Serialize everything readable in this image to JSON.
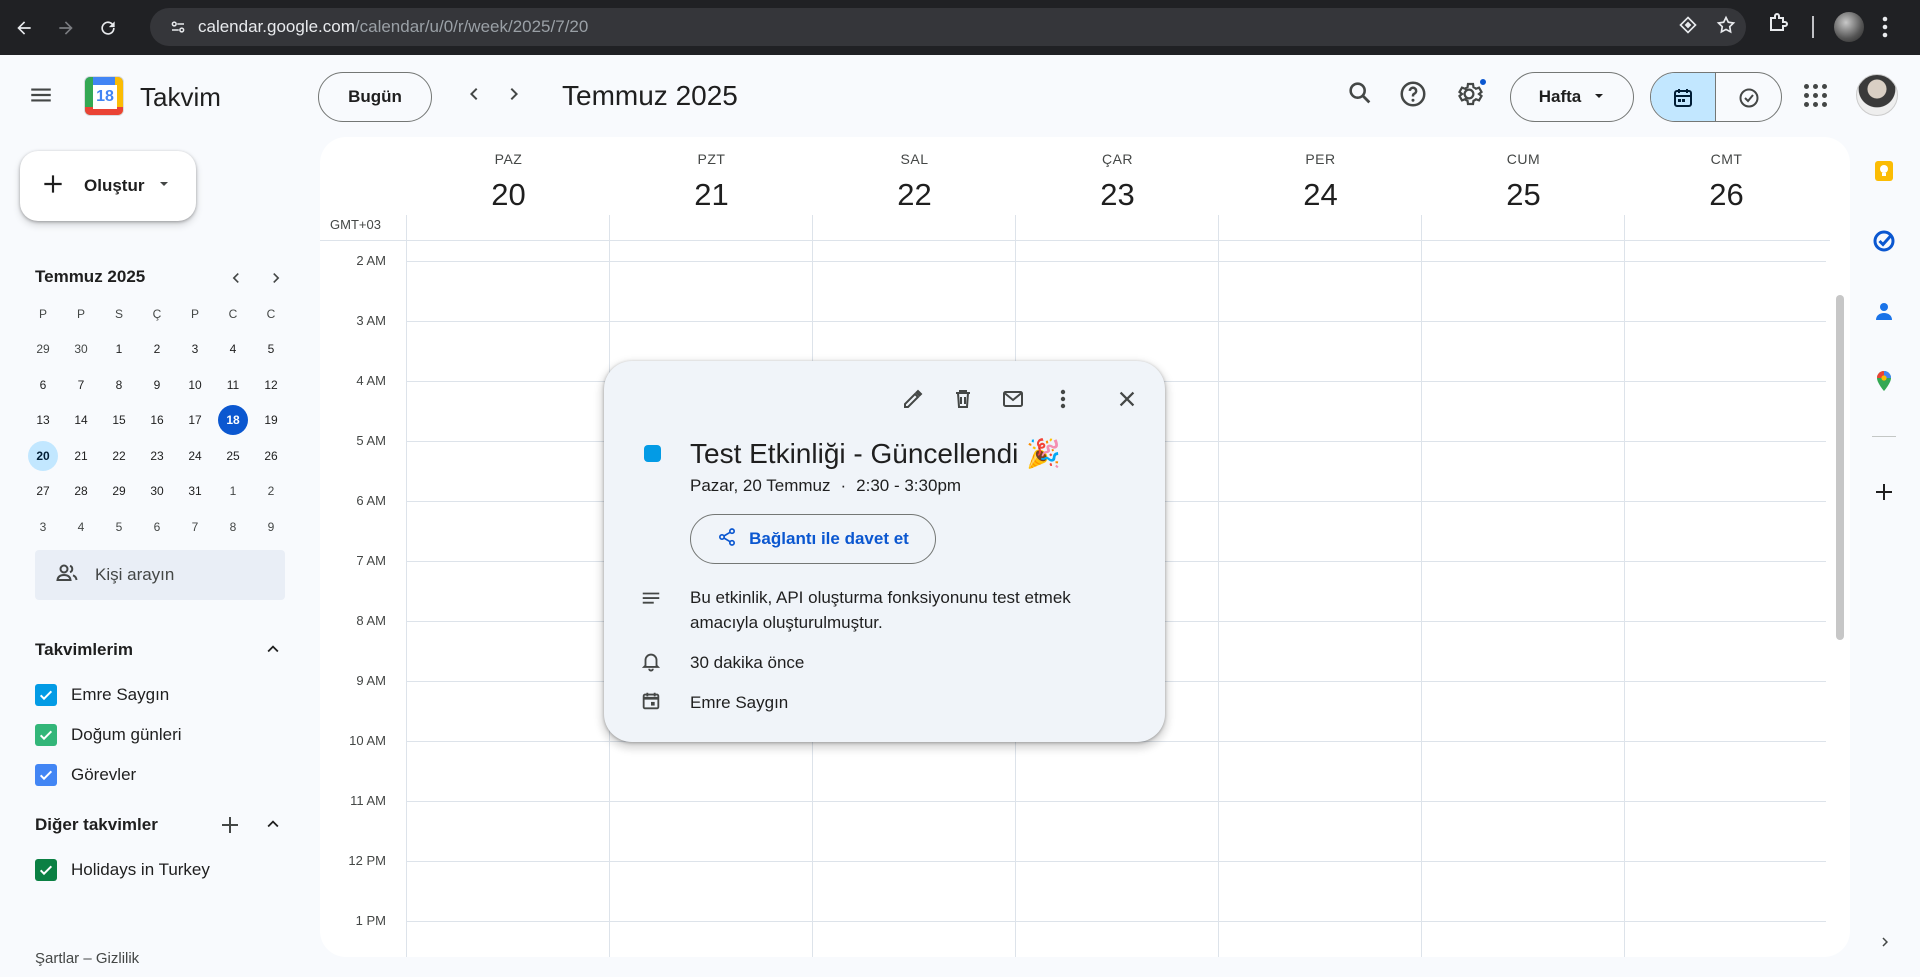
{
  "browser": {
    "url_host": "calendar.google.com",
    "url_path": "/calendar/u/0/r/week/2025/7/20"
  },
  "header": {
    "app_title": "Takvim",
    "logo_number": "18",
    "today_label": "Bugün",
    "range_title": "Temmuz 2025",
    "view_label": "Hafta"
  },
  "sidebar": {
    "create_label": "Oluştur",
    "mini_cal": {
      "title": "Temmuz 2025",
      "weekdays": [
        "P",
        "P",
        "S",
        "Ç",
        "P",
        "C",
        "C"
      ],
      "weeks": [
        [
          "29",
          "30",
          "1",
          "2",
          "3",
          "4",
          "5"
        ],
        [
          "6",
          "7",
          "8",
          "9",
          "10",
          "11",
          "12"
        ],
        [
          "13",
          "14",
          "15",
          "16",
          "17",
          "18",
          "19"
        ],
        [
          "20",
          "21",
          "22",
          "23",
          "24",
          "25",
          "26"
        ],
        [
          "27",
          "28",
          "29",
          "30",
          "31",
          "1",
          "2"
        ],
        [
          "3",
          "4",
          "5",
          "6",
          "7",
          "8",
          "9"
        ]
      ]
    },
    "people_search_placeholder": "Kişi arayın",
    "my_calendars_title": "Takvimlerim",
    "my_calendars": [
      {
        "label": "Emre Saygın",
        "color": "#039be5"
      },
      {
        "label": "Doğum günleri",
        "color": "#33b679"
      },
      {
        "label": "Görevler",
        "color": "#4285f4"
      }
    ],
    "other_calendars_title": "Diğer takvimler",
    "other_calendars": [
      {
        "label": "Holidays in Turkey",
        "color": "#0b8043"
      }
    ],
    "footer": "Şartlar – Gizlilik"
  },
  "week": {
    "timezone": "GMT+03",
    "days": [
      {
        "name": "PAZ",
        "num": "20"
      },
      {
        "name": "PZT",
        "num": "21"
      },
      {
        "name": "SAL",
        "num": "22"
      },
      {
        "name": "ÇAR",
        "num": "23"
      },
      {
        "name": "PER",
        "num": "24"
      },
      {
        "name": "CUM",
        "num": "25"
      },
      {
        "name": "CMT",
        "num": "26"
      }
    ],
    "hours": [
      "2 AM",
      "3 AM",
      "4 AM",
      "5 AM",
      "6 AM",
      "7 AM",
      "8 AM",
      "9 AM",
      "10 AM",
      "11 AM",
      "12 PM",
      "1 PM"
    ]
  },
  "event_popover": {
    "title": "Test Etkinliği - Güncellendi",
    "emoji": "🎉",
    "date": "Pazar, 20 Temmuz",
    "separator": "·",
    "time": "2:30 - 3:30pm",
    "invite_label": "Bağlantı ile davet et",
    "description": "Bu etkinlik, API oluşturma fonksiyonunu test etmek amacıyla oluşturulmuştur.",
    "reminder": "30 dakika önce",
    "calendar": "Emre Saygın",
    "color": "#039be5"
  }
}
